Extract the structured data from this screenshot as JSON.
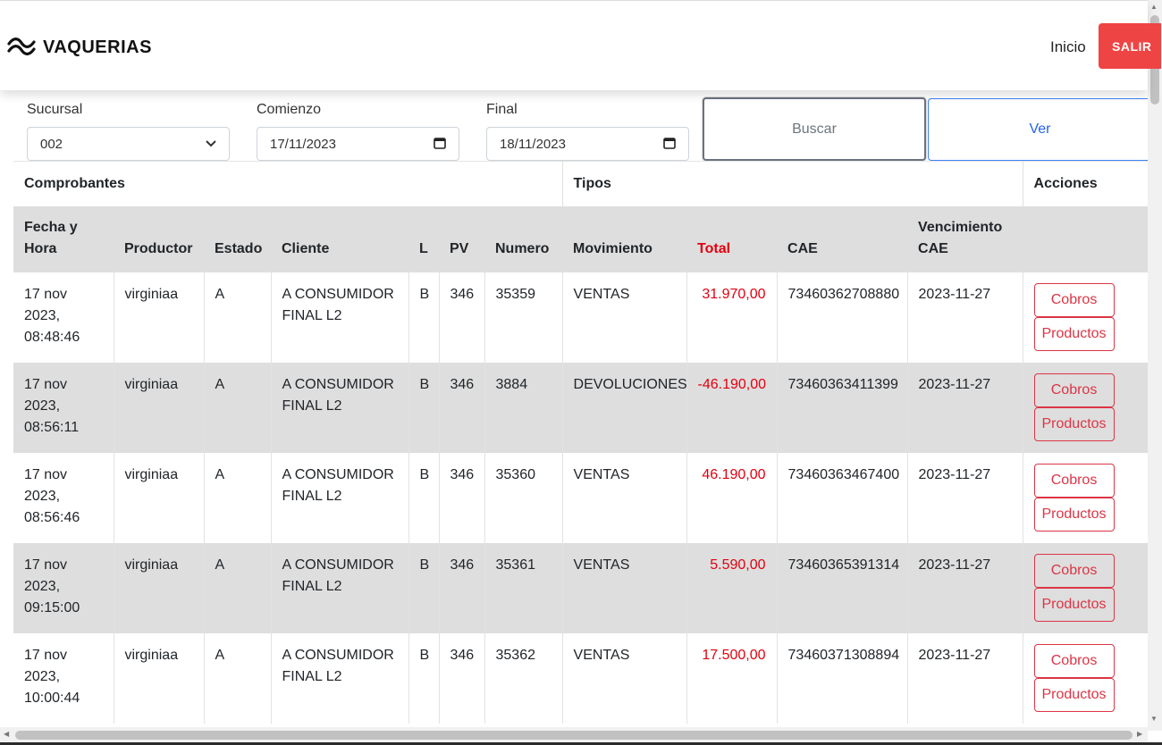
{
  "brand": {
    "name": "VAQUERIAS",
    "icon": "wave-logo-icon"
  },
  "nav": {
    "inicio": "Inicio",
    "salir": "SALIR"
  },
  "filters": {
    "sucursal_label": "Sucursal",
    "sucursal_value": "002",
    "comienzo_label": "Comienzo",
    "comienzo_value": "17/11/2023",
    "final_label": "Final",
    "final_value": "18/11/2023",
    "buscar": "Buscar",
    "ver": "Ver"
  },
  "table": {
    "groups": [
      "Comprobantes",
      "Tipos",
      "Acciones"
    ],
    "headers": {
      "fecha": "Fecha y Hora",
      "productor": "Productor",
      "estado": "Estado",
      "cliente": "Cliente",
      "l": "L",
      "pv": "PV",
      "numero": "Numero",
      "movimiento": "Movimiento",
      "total": "Total",
      "cae": "CAE",
      "vencimiento": "Vencimiento CAE"
    },
    "actions": {
      "cobros": "Cobros",
      "productos": "Productos"
    },
    "rows": [
      {
        "fecha": "17 nov 2023, 08:48:46",
        "productor": "virginiaa",
        "estado": "A",
        "cliente": "A CONSUMIDOR FINAL L2",
        "l": "B",
        "pv": "346",
        "numero": "35359",
        "movimiento": "VENTAS",
        "total": "31.970,00",
        "cae": "73460362708880",
        "vencimiento": "2023-11-27"
      },
      {
        "fecha": "17 nov 2023, 08:56:11",
        "productor": "virginiaa",
        "estado": "A",
        "cliente": "A CONSUMIDOR FINAL L2",
        "l": "B",
        "pv": "346",
        "numero": "3884",
        "movimiento": "DEVOLUCIONES",
        "total": "-46.190,00",
        "cae": "73460363411399",
        "vencimiento": "2023-11-27"
      },
      {
        "fecha": "17 nov 2023, 08:56:46",
        "productor": "virginiaa",
        "estado": "A",
        "cliente": "A CONSUMIDOR FINAL L2",
        "l": "B",
        "pv": "346",
        "numero": "35360",
        "movimiento": "VENTAS",
        "total": "46.190,00",
        "cae": "73460363467400",
        "vencimiento": "2023-11-27"
      },
      {
        "fecha": "17 nov 2023, 09:15:00",
        "productor": "virginiaa",
        "estado": "A",
        "cliente": "A CONSUMIDOR FINAL L2",
        "l": "B",
        "pv": "346",
        "numero": "35361",
        "movimiento": "VENTAS",
        "total": "5.590,00",
        "cae": "73460365391314",
        "vencimiento": "2023-11-27"
      },
      {
        "fecha": "17 nov 2023, 10:00:44",
        "productor": "virginiaa",
        "estado": "A",
        "cliente": "A CONSUMIDOR FINAL L2",
        "l": "B",
        "pv": "346",
        "numero": "35362",
        "movimiento": "VENTAS",
        "total": "17.500,00",
        "cae": "73460371308894",
        "vencimiento": "2023-11-27"
      }
    ]
  },
  "colors": {
    "salir_bg": "#ef4444",
    "total_red": "#e3000f",
    "action_red": "#dc3545",
    "ver_blue": "#2563eb",
    "row_alt": "#dedede"
  }
}
